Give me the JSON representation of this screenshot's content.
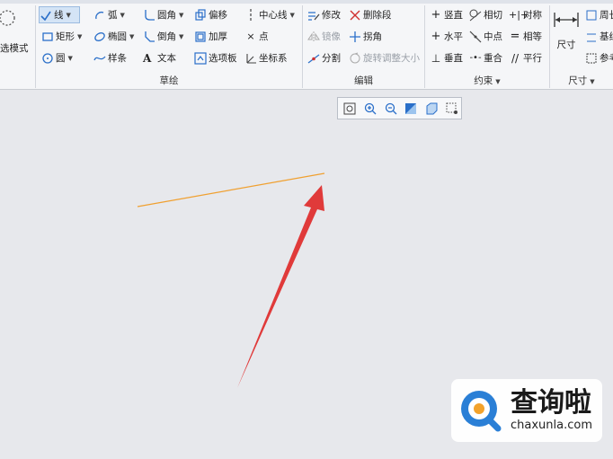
{
  "ribbon": {
    "sketch_mode_partial": "选模式",
    "sketch": {
      "line": "线",
      "rectangle": "矩形",
      "circle": "圆",
      "arc": "弧",
      "ellipse": "椭圆",
      "spline": "样条",
      "fillet": "圆角",
      "chamfer": "倒角",
      "text": "文本",
      "offset": "偏移",
      "thicken": "加厚",
      "palette": "选项板",
      "centerline": "中心线",
      "point": "点",
      "coordinate_system": "坐标系",
      "group_label": "草绘"
    },
    "edit": {
      "modify": "修改",
      "delete_segment": "删除段",
      "mirror": "镜像",
      "corner": "拐角",
      "divide": "分割",
      "rotate_resize": "旋转调整大小",
      "group_label": "编辑"
    },
    "constrain": {
      "vertical": "竖直",
      "tangent": "相切",
      "symmetric": "对称",
      "horizontal": "水平",
      "midpoint": "中点",
      "equal": "相等",
      "perpendicular": "垂直",
      "coincident": "重合",
      "parallel": "平行",
      "group_label": "约束"
    },
    "dimension": {
      "dimension": "尺寸",
      "perimeter_partial": "周长",
      "baseline_partial": "基线",
      "reference_partial": "参考",
      "group_label": "尺寸"
    }
  },
  "canvas": {
    "line_color": "#f0a030",
    "arrow_color": "#e03a3a"
  },
  "watermark": {
    "brand": "查询啦",
    "domain": "chaxunla.com"
  }
}
